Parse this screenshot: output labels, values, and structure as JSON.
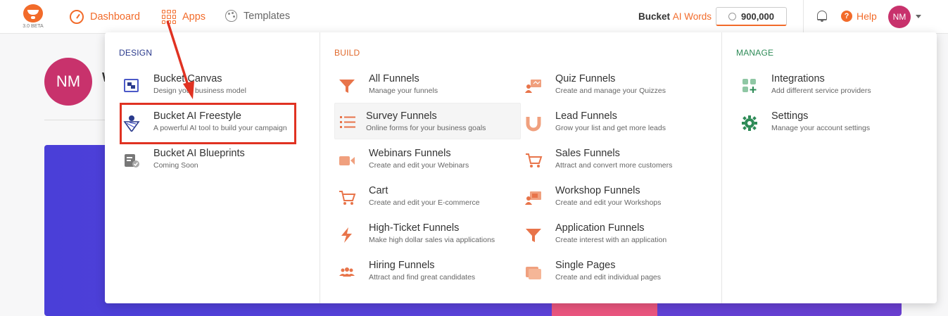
{
  "topbar": {
    "logo_version": "3.0 BETA",
    "nav": [
      {
        "label": "Dashboard",
        "icon": "gauge-icon"
      },
      {
        "label": "Apps",
        "icon": "grid-icon"
      },
      {
        "label": "Templates",
        "icon": "palette-icon"
      }
    ],
    "bucket_label": "Bucket",
    "ai_words_label": "AI Words",
    "words_count": "900,000",
    "help_label": "Help",
    "avatar_initials": "NM"
  },
  "page": {
    "avatar_initials": "NM",
    "welcome_fragment": "W"
  },
  "menu": {
    "design": {
      "heading": "DESIGN",
      "items": [
        {
          "title": "Bucket Canvas",
          "desc": "Design your business model",
          "icon": "canvas-icon"
        },
        {
          "title": "Bucket AI Freestyle",
          "desc": "A powerful AI tool to build your campaign",
          "icon": "ai-freestyle-icon"
        },
        {
          "title": "Bucket AI Blueprints",
          "desc": "Coming Soon",
          "icon": "blueprint-icon"
        }
      ]
    },
    "build": {
      "heading": "BUILD",
      "items": [
        {
          "title": "All Funnels",
          "desc": "Manage your funnels",
          "icon": "funnel-icon"
        },
        {
          "title": "Quiz Funnels",
          "desc": "Create and manage your Quizzes",
          "icon": "quiz-icon"
        },
        {
          "title": "Survey Funnels",
          "desc": "Online forms for your business goals",
          "icon": "list-icon"
        },
        {
          "title": "Lead Funnels",
          "desc": "Grow your list and get more leads",
          "icon": "magnet-icon"
        },
        {
          "title": "Webinars Funnels",
          "desc": "Create and edit your Webinars",
          "icon": "video-icon"
        },
        {
          "title": "Sales Funnels",
          "desc": "Attract and convert more customers",
          "icon": "cart-icon"
        },
        {
          "title": "Cart",
          "desc": "Create and edit your E-commerce",
          "icon": "cart-icon"
        },
        {
          "title": "Workshop Funnels",
          "desc": "Create and edit your Workshops",
          "icon": "workshop-icon"
        },
        {
          "title": "High-Ticket Funnels",
          "desc": "Make high dollar sales via applications",
          "icon": "bolt-icon"
        },
        {
          "title": "Application Funnels",
          "desc": "Create interest with an application",
          "icon": "funnel-icon"
        },
        {
          "title": "Hiring Funnels",
          "desc": "Attract and find great candidates",
          "icon": "people-icon"
        },
        {
          "title": "Single Pages",
          "desc": "Create and edit individual pages",
          "icon": "pages-icon"
        }
      ]
    },
    "manage": {
      "heading": "MANAGE",
      "items": [
        {
          "title": "Integrations",
          "desc": "Add different service providers",
          "icon": "integrations-icon"
        },
        {
          "title": "Settings",
          "desc": "Manage your account settings",
          "icon": "gear-icon"
        }
      ]
    }
  },
  "colors": {
    "brand_orange": "#f26b2a",
    "design_heading": "#2a3a8c",
    "manage_heading": "#2e8b57",
    "highlight_box": "#e03222",
    "avatar": "#c8326c",
    "banner": "#4a3fd8"
  }
}
